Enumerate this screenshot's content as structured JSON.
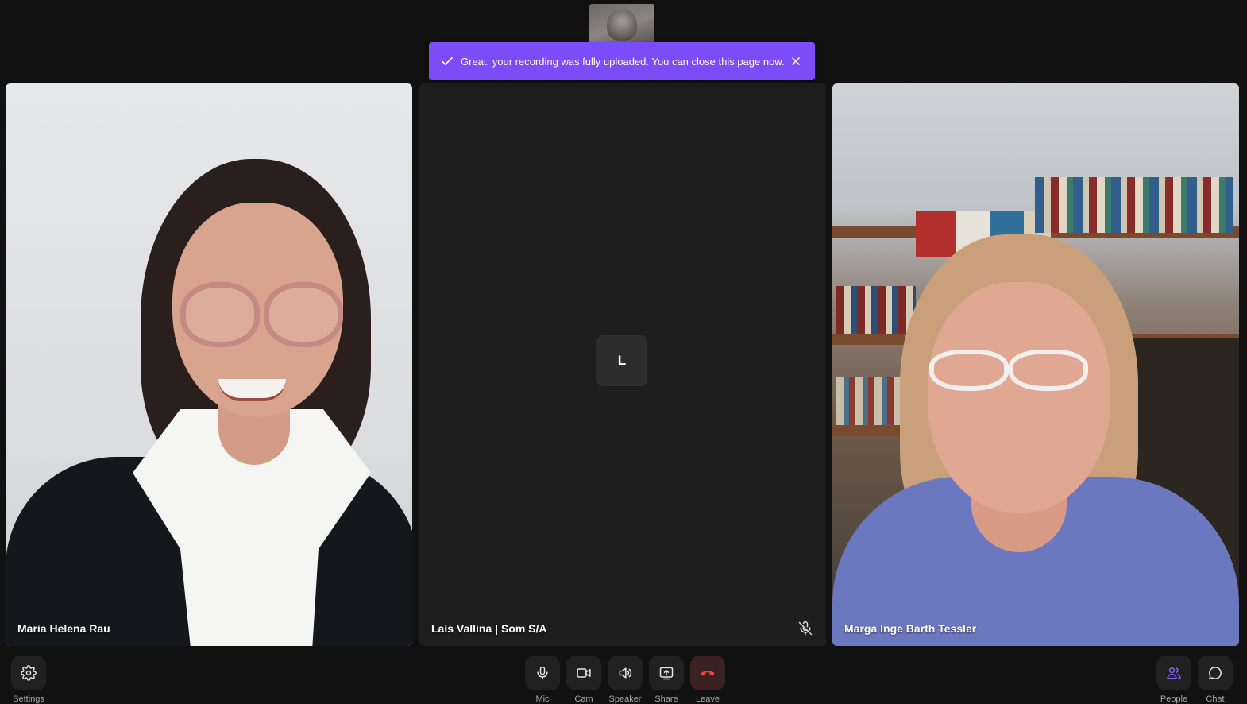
{
  "toast": {
    "message": "Great, your recording was fully uploaded. You can close this page now.",
    "color": "#7b4cf7",
    "icon": "check-icon",
    "close_icon": "close-icon"
  },
  "participants": [
    {
      "name": "Maria Helena Rau",
      "video": true
    },
    {
      "name": "Laís Vallina | Som S/A",
      "video": false,
      "avatar_initial": "L",
      "muted": true
    },
    {
      "name": "Marga Inge Barth Tessler",
      "video": true
    }
  ],
  "controls": {
    "settings": {
      "label": "Settings",
      "icon": "gear-icon"
    },
    "mic": {
      "label": "Mic",
      "icon": "microphone-icon"
    },
    "cam": {
      "label": "Cam",
      "icon": "video-camera-icon"
    },
    "speaker": {
      "label": "Speaker",
      "icon": "speaker-icon"
    },
    "share": {
      "label": "Share",
      "icon": "screen-share-icon"
    },
    "leave": {
      "label": "Leave",
      "icon": "hang-up-icon",
      "color": "#ef4444"
    },
    "people": {
      "label": "People",
      "icon": "people-icon",
      "color": "#8b5cf6"
    },
    "chat": {
      "label": "Chat",
      "icon": "chat-bubble-icon"
    }
  }
}
